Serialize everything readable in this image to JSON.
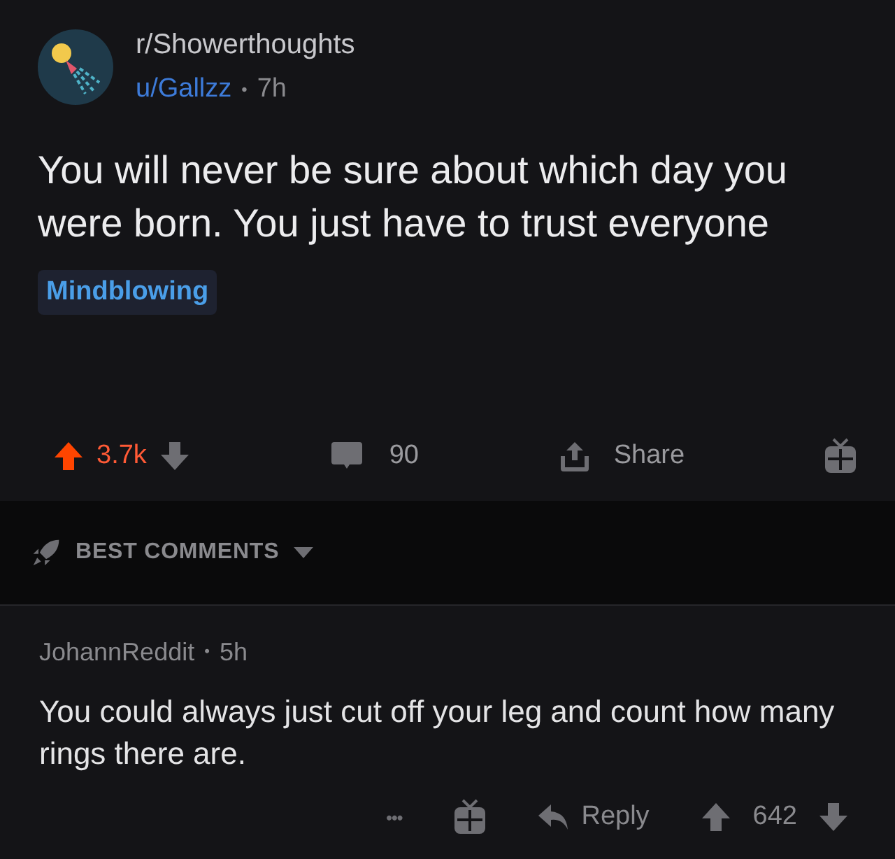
{
  "post": {
    "subreddit": "r/Showerthoughts",
    "author": "u/Gallzz",
    "separator": "•",
    "age": "7h",
    "title": "You will never be sure about which day you were born. You just have to trust everyone",
    "flair": "Mindblowing",
    "score": "3.7k",
    "upvoted": true,
    "comments": "90",
    "share": "Share"
  },
  "sort": {
    "label": "BEST COMMENTS"
  },
  "comment": {
    "author": "JohannReddit",
    "separator": "•",
    "age": "5h",
    "body": "You could always just cut off your leg and count how many rings there are.",
    "more": "•••",
    "reply": "Reply",
    "score": "642",
    "upvoted": false
  }
}
